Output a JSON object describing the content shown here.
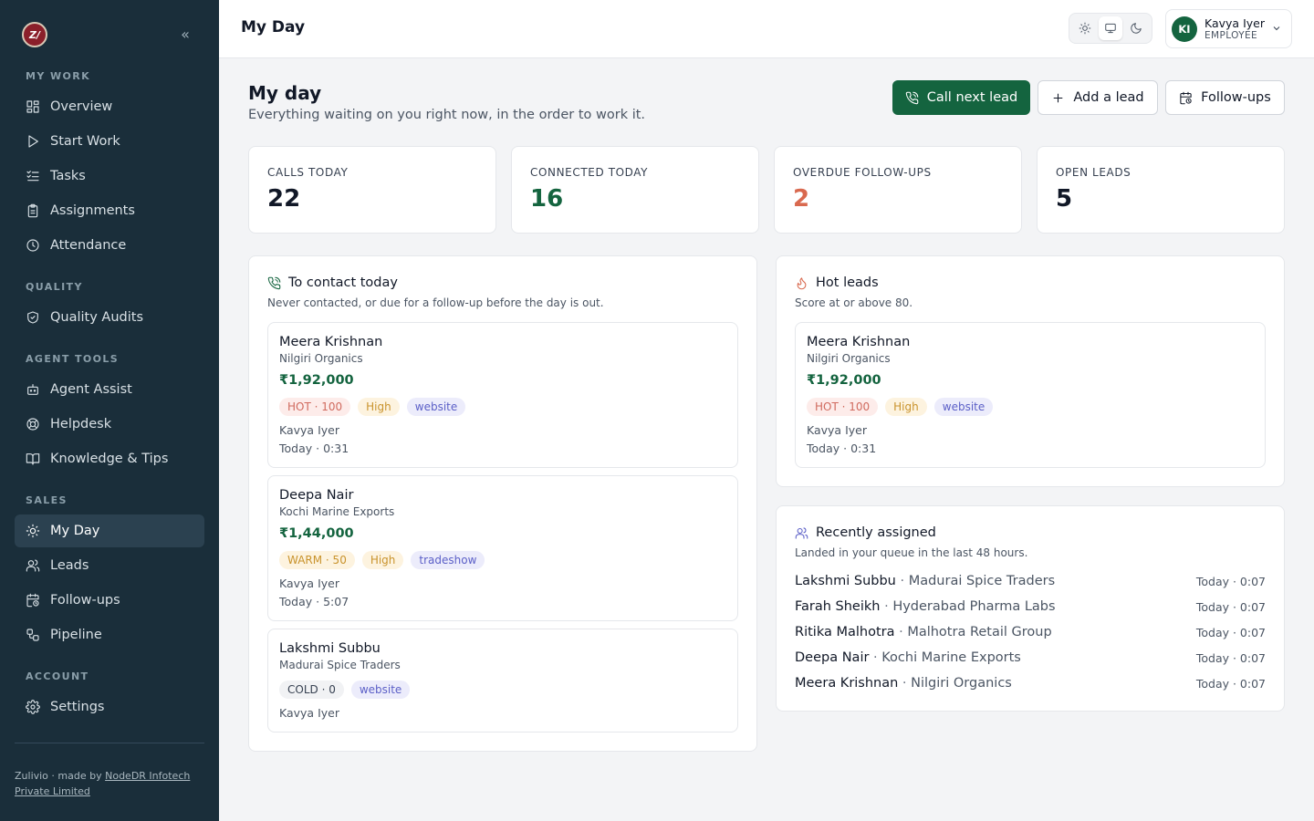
{
  "brand": {
    "logo_text": "Z/",
    "footer_prefix": "Zulivio · made by ",
    "footer_link": "NodeDR Infotech Private Limited"
  },
  "sidebar": {
    "collapse_icon": "chevrons-left-icon",
    "sections": [
      {
        "title": "MY WORK",
        "items": [
          {
            "label": "Overview",
            "icon": "grid-icon"
          },
          {
            "label": "Start Work",
            "icon": "play-icon"
          },
          {
            "label": "Tasks",
            "icon": "list-check-icon"
          },
          {
            "label": "Assignments",
            "icon": "clipboard-icon"
          },
          {
            "label": "Attendance",
            "icon": "clock-icon"
          }
        ]
      },
      {
        "title": "QUALITY",
        "items": [
          {
            "label": "Quality Audits",
            "icon": "shield-check-icon"
          }
        ]
      },
      {
        "title": "AGENT TOOLS",
        "items": [
          {
            "label": "Agent Assist",
            "icon": "bot-icon"
          },
          {
            "label": "Helpdesk",
            "icon": "lifebuoy-icon"
          },
          {
            "label": "Knowledge & Tips",
            "icon": "book-icon"
          }
        ]
      },
      {
        "title": "SALES",
        "items": [
          {
            "label": "My Day",
            "icon": "sun-icon",
            "active": true
          },
          {
            "label": "Leads",
            "icon": "users-icon"
          },
          {
            "label": "Follow-ups",
            "icon": "calendar-clock-icon"
          },
          {
            "label": "Pipeline",
            "icon": "workflow-icon"
          }
        ]
      },
      {
        "title": "ACCOUNT",
        "items": [
          {
            "label": "Settings",
            "icon": "gear-icon"
          }
        ]
      }
    ]
  },
  "topbar": {
    "title": "My Day",
    "theme_options": [
      "sun-icon",
      "monitor-icon",
      "moon-icon"
    ],
    "theme_selected": "monitor-icon",
    "user": {
      "initials": "KI",
      "name": "Kavya Iyer",
      "role": "EMPLOYEE"
    }
  },
  "header": {
    "title": "My day",
    "subtitle": "Everything waiting on you right now, in the order to work it.",
    "actions": {
      "call_next": "Call next lead",
      "add_lead": "Add a lead",
      "follow_ups": "Follow-ups"
    }
  },
  "stats": [
    {
      "label": "CALLS TODAY",
      "value": "22",
      "color": "#111827"
    },
    {
      "label": "CONNECTED TODAY",
      "value": "16",
      "color": "#14643f"
    },
    {
      "label": "OVERDUE FOLLOW-UPS",
      "value": "2",
      "color": "#d9694f"
    },
    {
      "label": "OPEN LEADS",
      "value": "5",
      "color": "#111827"
    }
  ],
  "to_contact": {
    "title": "To contact today",
    "subtitle": "Never contacted, or due for a follow-up before the day is out.",
    "leads": [
      {
        "name": "Meera Krishnan",
        "company": "Nilgiri Organics",
        "amount": "₹1,92,000",
        "temp": "HOT · 100",
        "priority": "High",
        "source": "website",
        "owner": "Kavya Iyer",
        "time": "Today · 0:31"
      },
      {
        "name": "Deepa Nair",
        "company": "Kochi Marine Exports",
        "amount": "₹1,44,000",
        "temp": "WARM · 50",
        "priority": "High",
        "source": "tradeshow",
        "owner": "Kavya Iyer",
        "time": "Today · 5:07"
      },
      {
        "name": "Lakshmi Subbu",
        "company": "Madurai Spice Traders",
        "temp": "COLD · 0",
        "source": "website",
        "owner": "Kavya Iyer"
      }
    ]
  },
  "hot_leads": {
    "title": "Hot leads",
    "subtitle": "Score at or above 80.",
    "lead": {
      "name": "Meera Krishnan",
      "company": "Nilgiri Organics",
      "amount": "₹1,92,000",
      "temp": "HOT · 100",
      "priority": "High",
      "source": "website",
      "owner": "Kavya Iyer",
      "time": "Today · 0:31"
    }
  },
  "recently_assigned": {
    "title": "Recently assigned",
    "subtitle": "Landed in your queue in the last 48 hours.",
    "separator": " · ",
    "rows": [
      {
        "name": "Lakshmi Subbu",
        "company": "Madurai Spice Traders",
        "time": "Today · 0:07"
      },
      {
        "name": "Farah Sheikh",
        "company": "Hyderabad Pharma Labs",
        "time": "Today · 0:07"
      },
      {
        "name": "Ritika Malhotra",
        "company": "Malhotra Retail Group",
        "time": "Today · 0:07"
      },
      {
        "name": "Deepa Nair",
        "company": "Kochi Marine Exports",
        "time": "Today · 0:07"
      },
      {
        "name": "Meera Krishnan",
        "company": "Nilgiri Organics",
        "time": "Today · 0:07"
      }
    ]
  },
  "colors": {
    "accent": "#14643f",
    "sidebar": "#1a2e3a",
    "overdue": "#d9694f"
  }
}
